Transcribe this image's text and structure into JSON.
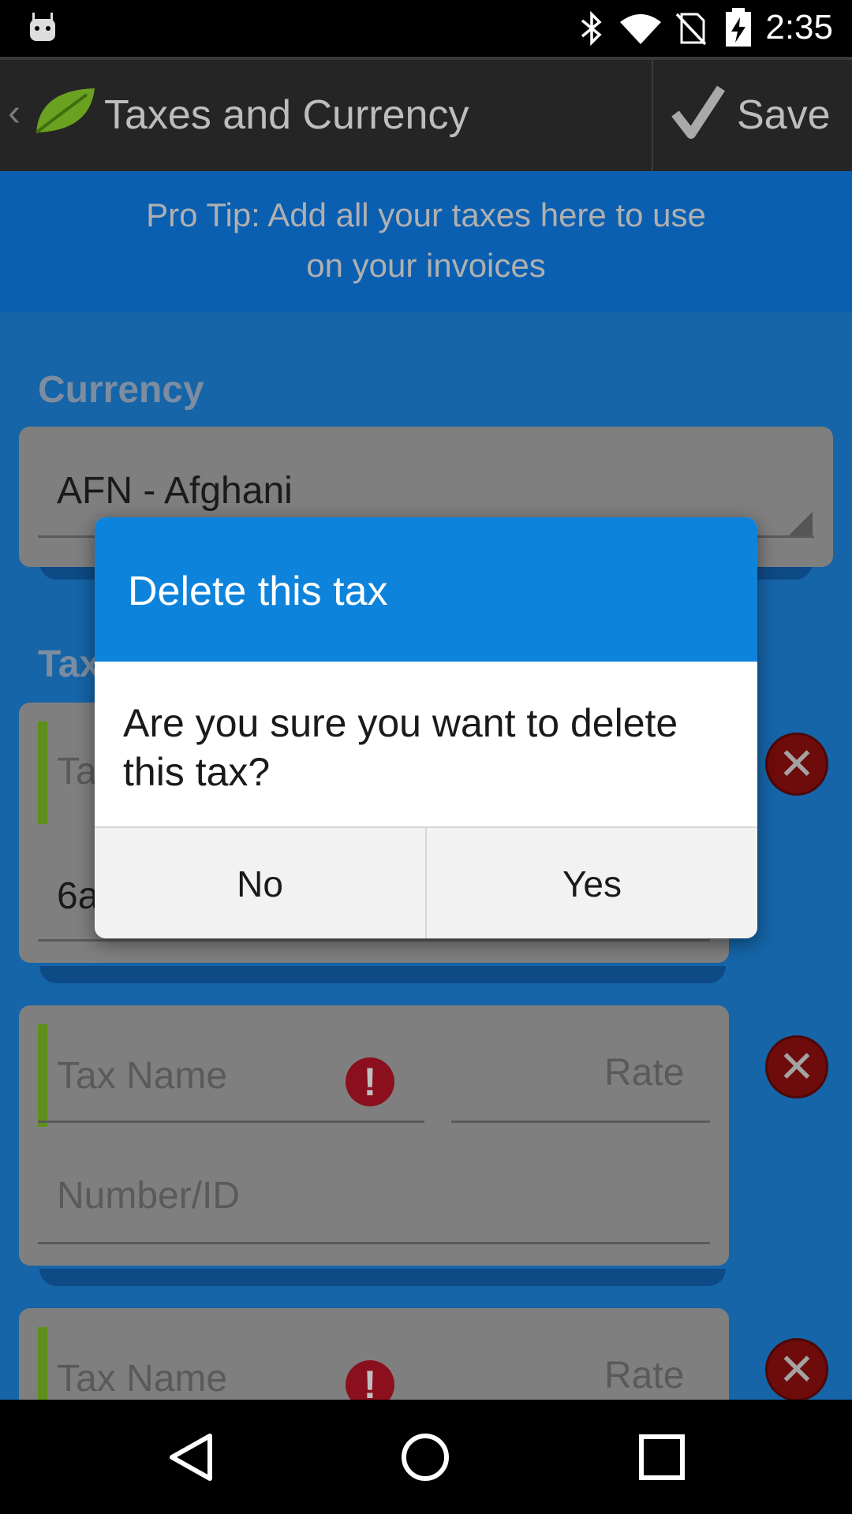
{
  "status_bar": {
    "time": "2:35",
    "icons": [
      "android-icon",
      "bluetooth-icon",
      "wifi-icon",
      "no-sim-icon",
      "battery-charging-icon"
    ]
  },
  "action_bar": {
    "back_glyph": "‹",
    "title": "Taxes and Currency",
    "save_label": "Save"
  },
  "pro_tip": {
    "line1": "Pro Tip: Add all your taxes here to use",
    "line2": "on your invoices"
  },
  "currency": {
    "section_title": "Currency",
    "selected": "AFN - Afghani"
  },
  "taxes": {
    "section_title": "Tax",
    "items": [
      {
        "name_placeholder": "Ta",
        "number_value": "6a"
      },
      {
        "name_placeholder": "Tax Name",
        "rate_placeholder": "Rate",
        "number_placeholder": "Number/ID"
      },
      {
        "name_placeholder": "Tax Name",
        "rate_placeholder": "Rate"
      }
    ],
    "error_glyph": "!",
    "delete_glyph": "✕"
  },
  "dialog": {
    "title": "Delete this tax",
    "message": "Are you sure you want to delete this tax?",
    "no_label": "No",
    "yes_label": "Yes"
  },
  "colors": {
    "dialog_header": "#0e83db",
    "page_background": "#1565a8",
    "action_bar": "#252525"
  }
}
